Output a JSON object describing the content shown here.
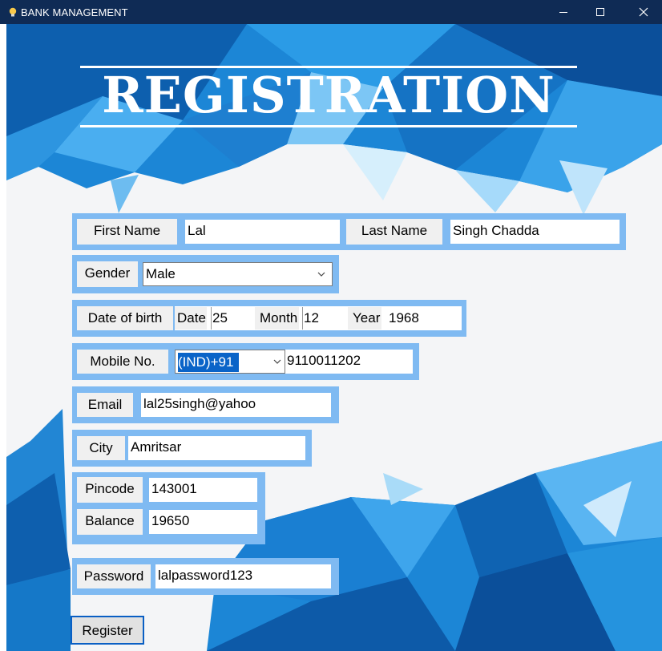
{
  "window": {
    "title": "BANK MANAGEMENT",
    "icon": "lightbulb-icon",
    "controls": [
      "minimize-icon",
      "maximize-icon",
      "close-icon"
    ]
  },
  "colors": {
    "titlebar": "#0f2b55",
    "frame": "#7fbaf2",
    "background_light": "#f4f5f7",
    "background_blue": "#1c86d6"
  },
  "header": {
    "title": "REGISTRATION"
  },
  "form": {
    "first_name": {
      "label": "First Name",
      "value": "Lal"
    },
    "last_name": {
      "label": "Last Name",
      "value": "Singh Chadda"
    },
    "gender": {
      "label": "Gender",
      "value": "Male"
    },
    "dob": {
      "label": "Date of birth",
      "date_label": "Date",
      "date_value": "25",
      "month_label": "Month",
      "month_value": "12",
      "year_label": "Year",
      "year_value": "1968"
    },
    "mobile": {
      "label": "Mobile No.",
      "code": "(IND)+91",
      "value": "9110011202"
    },
    "email": {
      "label": "Email",
      "value": "lal25singh@yahoo"
    },
    "city": {
      "label": "City",
      "value": "Amritsar"
    },
    "pincode": {
      "label": "Pincode",
      "value": "143001"
    },
    "balance": {
      "label": "Balance",
      "value": "19650"
    },
    "password": {
      "label": "Password",
      "value": "lalpassword123"
    },
    "register_label": "Register"
  }
}
